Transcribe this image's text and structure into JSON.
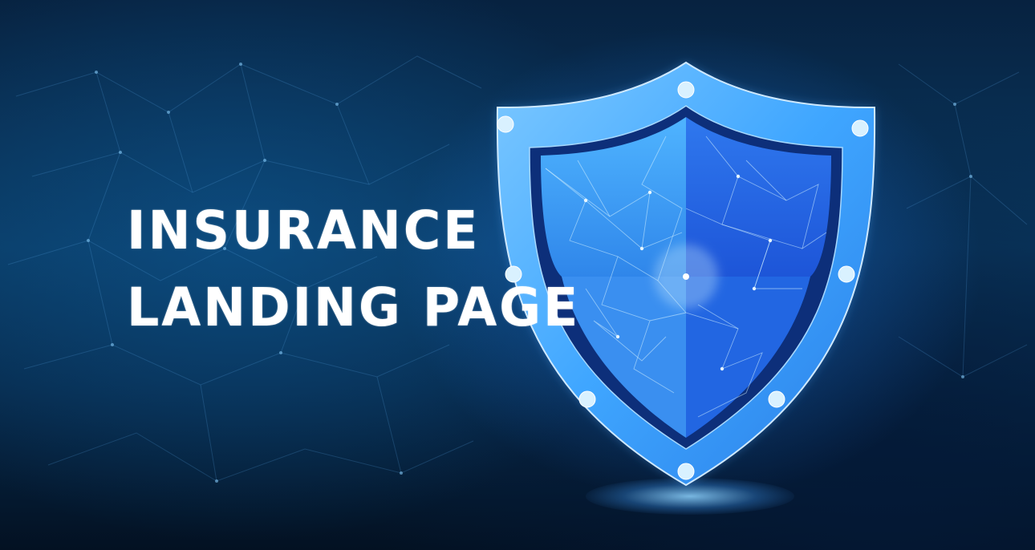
{
  "hero": {
    "title_line1": "INSURANCE",
    "title_line2": "LANDING PAGE",
    "illustration_icon": "shield-icon"
  },
  "colors": {
    "background_dark": "#03101f",
    "background_mid": "#0a3a63",
    "shield_light": "#3fa6ff",
    "shield_deep": "#1d5fe0",
    "text": "#ffffff"
  }
}
